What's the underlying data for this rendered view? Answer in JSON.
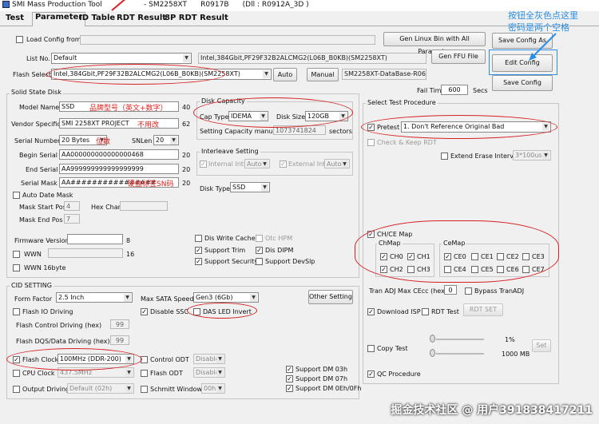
{
  "window": {
    "title": "SMI Mass Production Tool",
    "title_extra": "- SM2258XT      R0917B      (Dll : R0912A_3D )",
    "tabs": [
      "Test",
      "Parameter",
      "ID Table",
      "RDT Result",
      "8P RDT Result"
    ]
  },
  "header": {
    "load_config_label": "Load Config from",
    "list_no_label": "List No.",
    "list_no_value": "Default",
    "flash_select_label": "Flash Select",
    "flash_select_value": "Intel,384Gbit,PF29F32B2ALCMG2(L06B_B0KB)(SM2258XT)",
    "flash_info_value": "Intel,384Gbit,PF29F32B2ALCMG2(L06B_B0KB)(SM2258XT)",
    "auto_button": "Auto",
    "manual_button": "Manual",
    "database_value": "SM2258XT-DataBase-R0611",
    "gen_linux_button": "Gen Linux Bin with All Parameter",
    "gen_ffu_button": "Gen FFU File",
    "save_config_as_button": "Save Config As",
    "edit_config_button": "Edit Config",
    "save_config_button": "Save Config",
    "fail_timeout_label": "Fail Timeout",
    "fail_timeout_value": "600",
    "secs_label": "Secs"
  },
  "solid_state": {
    "group_title": "Solid State Disk",
    "model_name_label": "Model Name",
    "model_name_value": "SSD",
    "model_name_len": "40",
    "vendor_label": "Vendor Specific",
    "vendor_value": "SMI 2258XT PROJECT",
    "vendor_len": "62",
    "serial_number_label": "Serial Number",
    "serial_number_value": "20 Bytes",
    "snlen_label": "SNLen",
    "snlen_value": "20",
    "begin_serial_label": "Begin Serial",
    "begin_serial_value": "AA000000000000000468",
    "begin_serial_len": "20",
    "end_serial_label": "End Serial",
    "end_serial_value": "AA999999999999999999",
    "end_serial_len": "20",
    "serial_mask_label": "Serial Mask",
    "serial_mask_value": "AA################",
    "serial_mask_len": "20",
    "auto_date_mask_label": "Auto Date Mask",
    "mask_start_label": "Mask Start Pos",
    "mask_start_value": "4",
    "hex_char_label": "Hex Char:",
    "mask_end_label": "Mask End Pos",
    "mask_end_value": "7",
    "firmware_label": "Firmware Version",
    "firmware_len": "8",
    "wwn_label": "WWN",
    "wwn_len": "16",
    "wwn16_label": "WWN 16byte"
  },
  "disk_capacity": {
    "group_title": "Disk Capacity",
    "cap_type_label": "Cap Type",
    "cap_type_value": "IDEMA",
    "disk_size_label": "Disk Size",
    "disk_size_value": "120GB",
    "setting_capacity_label": "Setting Capacity manually",
    "setting_capacity_value": "1073741824",
    "sectors_label": "sectors"
  },
  "interleave": {
    "group_title": "Interleave Setting",
    "internal_label": "Internal Intlv",
    "internal_value": "Auto",
    "external_label": "External Intlv",
    "external_value": "Auto",
    "disk_type_label": "Disk Type",
    "disk_type_value": "SSD"
  },
  "features": {
    "dis_write_cache": "Dis Write Cache",
    "otc_hpm": "Otc HPM",
    "support_trim": "Support Trim",
    "dis_dipm": "Dis DIPM",
    "support_security": "Support Security",
    "support_devslp": "Support DevSlp"
  },
  "cid": {
    "group_title": "CID SETTING",
    "form_factor_label": "Form Factor",
    "form_factor_value": "2.5 Inch",
    "max_sata_label": "Max SATA Speed",
    "max_sata_value": "Gen3 (6Gb)",
    "other_setting_button": "Other Setting",
    "flash_io_label": "Flash IO Driving",
    "disable_ssc_label": "Disable SSC",
    "das_led_label": "DAS LED Invert",
    "flash_control_label": "Flash Control Driving (hex)",
    "flash_control_value": "99",
    "flash_dqs_label": "Flash DQS/Data Driving (hex)",
    "flash_dqs_value": "99",
    "flash_clock_label": "Flash Clock",
    "flash_clock_value": "100MHz (DDR-200)",
    "control_odt_label": "Control ODT",
    "control_odt_value": "Disable",
    "cpu_clock_label": "CPU Clock",
    "cpu_clock_value": "437.5MHz",
    "flash_odt_label": "Flash ODT",
    "flash_odt_value": "Disable",
    "output_driving_label": "Output Driving",
    "output_driving_value": "Default (02h)",
    "schmitt_label": "Schmitt Window",
    "schmitt_value": "00h",
    "support_dm03": "Support DM 03h",
    "support_dm07": "Support DM 07h",
    "support_dm0e": "Support DM 0Eh/0Fh"
  },
  "select_test": {
    "group_title": "Select Test Procedure",
    "pretest_label": "Pretest",
    "pretest_value": "1. Don't Reference Original Bad",
    "check_keep_rdt": "Check & Keep RDT",
    "extend_erase_label": "Extend Erase Interval",
    "extend_erase_value": "3*100us",
    "ch_ce_map_label": "CH/CE Map",
    "chmap_title": "ChMap",
    "cemap_title": "CeMap",
    "ch_items": [
      "CH0",
      "CH1",
      "CH2",
      "CH3"
    ],
    "ce_items": [
      "CE0",
      "CE1",
      "CE2",
      "CE3",
      "CE4",
      "CE5",
      "CE6",
      "CE7"
    ],
    "tran_adj_label": "Tran ADJ Max CEcc (hex)",
    "tran_adj_value": "0",
    "bypass_label": "Bypass TranADJ",
    "download_isp_label": "Download ISP",
    "rdt_test_label": "RDT Test",
    "rdt_set_button": "RDT SET",
    "copy_test_label": "Copy Test",
    "copy_pct": "1%",
    "copy_mb": "1000 MB",
    "set_button": "Set",
    "qc_label": "QC Procedure"
  },
  "annotations": {
    "model_note": "品牌型号（英文+数字）",
    "vendor_note": "不用改",
    "serial_note": "位数",
    "mask_note": "硬盘标签SN码",
    "edit_note_line1": "按钮全灰色点这里",
    "edit_note_line2": "密码是两个空格",
    "watermark": "掘金技术社区 @ 用户391838417211",
    "ring_color": "#d62020",
    "blue_color": "#2a8ee6"
  }
}
